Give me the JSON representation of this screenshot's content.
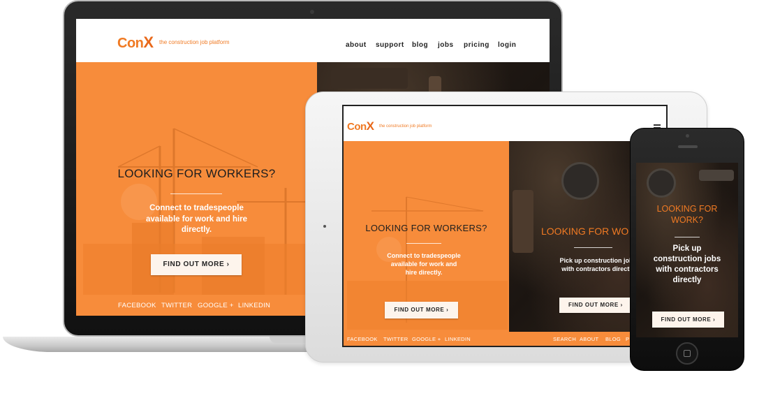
{
  "colors": {
    "brand_orange": "#f07a23",
    "panel_orange": "#f78c3b",
    "dark_bg": "#1f1813",
    "cta_bg": "#fdf4ec"
  },
  "brand": {
    "logo_text": "Con",
    "logo_x": "X",
    "tagline": "the construction job platform"
  },
  "laptop": {
    "nav": [
      "about",
      "support",
      "blog",
      "jobs",
      "pricing",
      "login"
    ],
    "headline": "LOOKING FOR WORKERS?",
    "subtext": "Connect to tradespeople available for work and hire directly.",
    "cta": "FIND OUT MORE ›",
    "social": [
      "FACEBOOK",
      "TWITTER",
      "GOOGLE +",
      "LINKEDIN"
    ]
  },
  "tablet": {
    "menu_icon": "hamburger-icon",
    "workers_headline": "LOOKING FOR WORKERS?",
    "workers_subtext": "Connect to tradespeople available for work and hire directly.",
    "workers_cta": "FIND OUT MORE ›",
    "work_headline": "LOOKING FOR WO",
    "work_subtext": "Pick up construction jobs with contractors directly",
    "work_cta": "FIND OUT MORE ›",
    "social": [
      "FACEBOOK",
      "TWITTER",
      "GOOGLE +",
      "LINKEDIN"
    ],
    "footer_nav": [
      "SEARCH",
      "ABOUT",
      "BLOG",
      "P"
    ]
  },
  "phone": {
    "headline": "LOOKING FOR WORK?",
    "subtext": "Pick up construction jobs with contractors directly",
    "cta": "FIND OUT MORE ›",
    "home_icon": "home-button-icon"
  }
}
